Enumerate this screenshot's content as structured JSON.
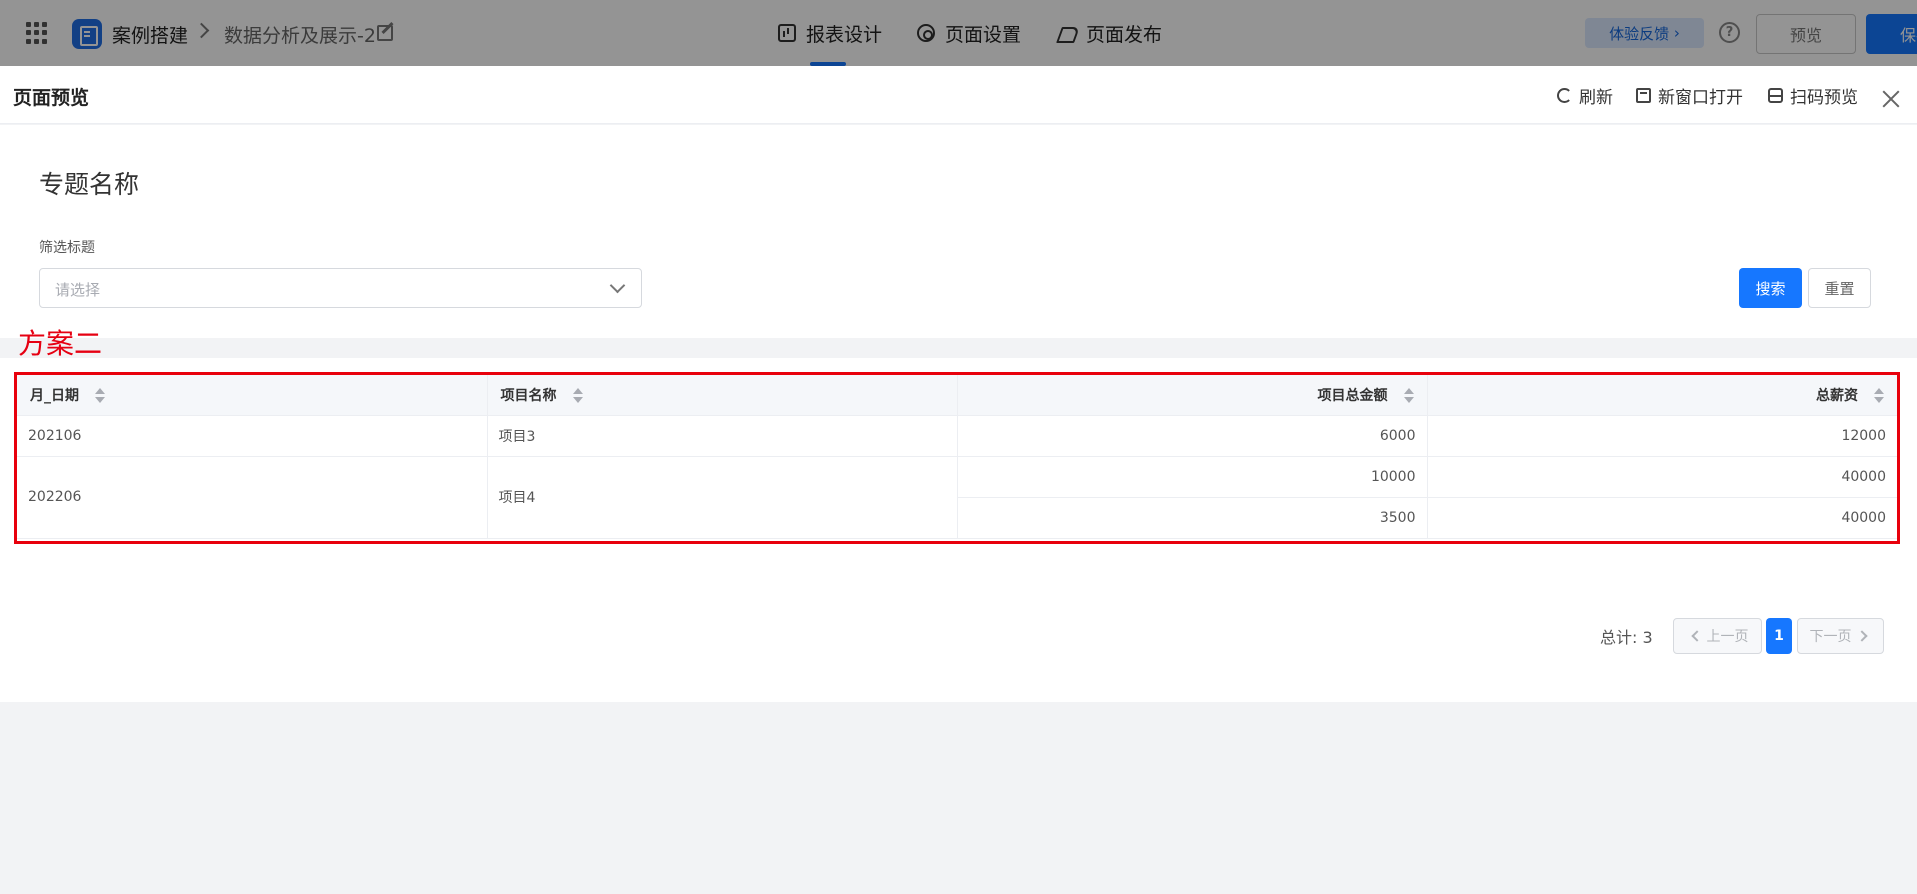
{
  "topbar": {
    "app_name": "案例搭建",
    "page_name": "数据分析及展示-2",
    "tabs": [
      {
        "label": "报表设计"
      },
      {
        "label": "页面设置"
      },
      {
        "label": "页面发布"
      }
    ],
    "feedback_label": "体验反馈",
    "help_label": "?",
    "preview_label": "预览",
    "save_label": "保存"
  },
  "drawer": {
    "title": "页面预览",
    "actions": {
      "refresh": "刷新",
      "new_window": "新窗口打开",
      "qr_preview": "扫码预览"
    }
  },
  "report": {
    "topic": "专题名称",
    "filter": {
      "label": "筛选标题",
      "placeholder": "请选择"
    },
    "search_label": "搜索",
    "reset_label": "重置",
    "annotation": "方案二",
    "table": {
      "headers": [
        "月_日期",
        "项目名称",
        "项目总金额",
        "总薪资"
      ],
      "rows": [
        {
          "date": "202106",
          "project": "项目3",
          "amounts": [
            {
              "total": "6000",
              "salary": "12000"
            }
          ]
        },
        {
          "date": "202206",
          "project": "项目4",
          "amounts": [
            {
              "total": "10000",
              "salary": "40000"
            },
            {
              "total": "3500",
              "salary": "40000"
            }
          ]
        }
      ]
    },
    "pagination": {
      "total_text": "总计: 3",
      "prev": "上一页",
      "current": "1",
      "next": "下一页"
    }
  },
  "colors": {
    "primary": "#1677ff",
    "annotation_red": "#e8000c",
    "feedback_bg": "#dbe8ff"
  }
}
